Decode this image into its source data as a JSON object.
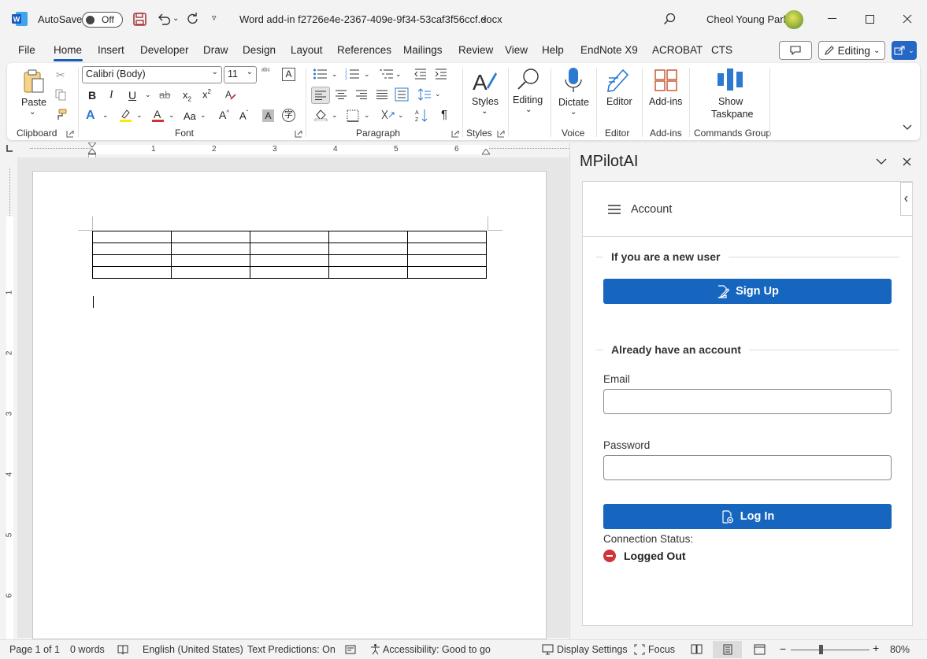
{
  "titlebar": {
    "autosave_label": "AutoSave",
    "autosave_state": "Off",
    "document_title": "Word add-in f2726e4e-2367-409e-9f34-53caf3f56ccf.docx",
    "user_name": "Cheol Young Park"
  },
  "menu": {
    "tabs": [
      "File",
      "Home",
      "Insert",
      "Developer",
      "Draw",
      "Design",
      "Layout",
      "References",
      "Mailings",
      "Review",
      "View",
      "Help",
      "EndNote X9",
      "ACROBAT",
      "CTS"
    ],
    "active_tab": "Home",
    "editing_label": "Editing"
  },
  "ribbon": {
    "clipboard": {
      "paste_label": "Paste",
      "group_label": "Clipboard"
    },
    "font": {
      "font_name": "Calibri (Body)",
      "font_size": "11",
      "group_label": "Font"
    },
    "paragraph": {
      "group_label": "Paragraph"
    },
    "styles": {
      "styles_label": "Styles",
      "group_label": "Styles"
    },
    "editing": {
      "label": "Editing"
    },
    "voice": {
      "dictate_label": "Dictate",
      "group_label": "Voice"
    },
    "editor": {
      "label": "Editor",
      "group_label": "Editor"
    },
    "addins": {
      "label": "Add-ins",
      "group_label": "Add-ins"
    },
    "commands": {
      "label_line1": "Show",
      "label_line2": "Taskpane",
      "group_label": "Commands Group"
    }
  },
  "ruler": {
    "numbers": [
      "1",
      "2",
      "3",
      "4",
      "5",
      "6"
    ],
    "vnumbers": [
      "1",
      "2",
      "3",
      "4",
      "5",
      "6"
    ]
  },
  "taskpane": {
    "title": "MPilotAI",
    "menu_label": "Account",
    "new_user_heading": "If you are a new user",
    "signup_label": "Sign Up",
    "existing_heading": "Already have an account",
    "email_label": "Email",
    "email_value": "",
    "password_label": "Password",
    "password_value": "",
    "login_label": "Log In",
    "connection_label": "Connection Status:",
    "connection_value": "Logged Out"
  },
  "statusbar": {
    "page": "Page 1 of 1",
    "words": "0 words",
    "language": "English (United States)",
    "text_predictions": "Text Predictions: On",
    "accessibility": "Accessibility: Good to go",
    "display_settings": "Display Settings",
    "focus": "Focus",
    "zoom": "80%"
  },
  "colors": {
    "accent": "#185abd",
    "pane_button": "#1666c0",
    "status_error": "#d13438"
  }
}
